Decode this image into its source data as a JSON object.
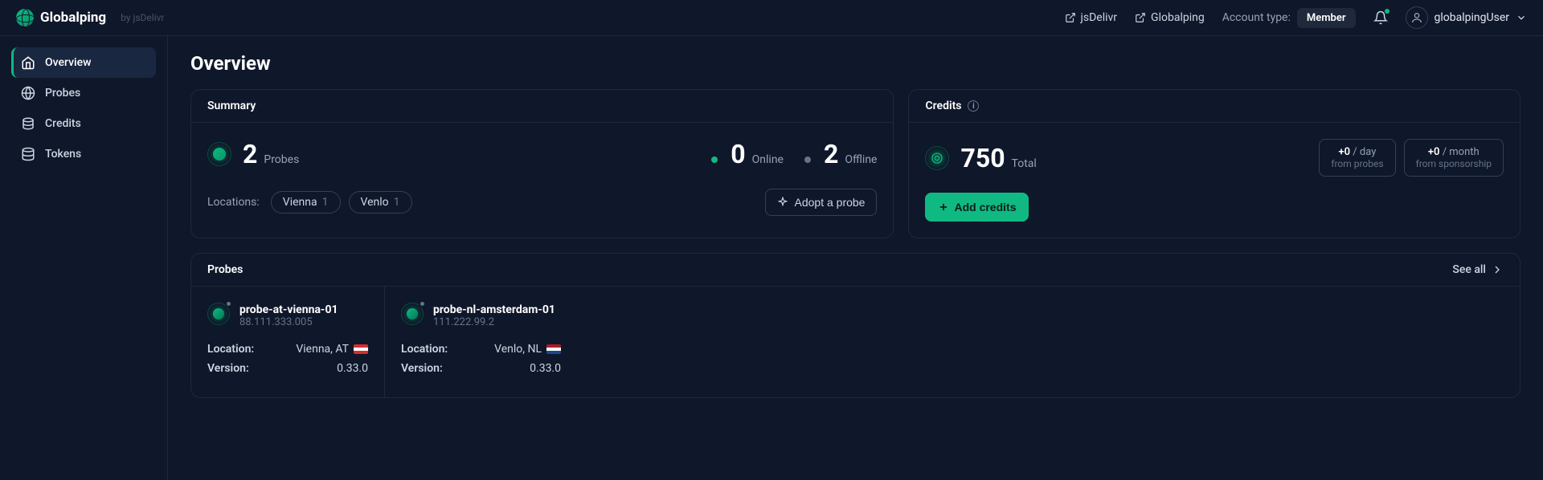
{
  "header": {
    "brand": "Globalping",
    "byline": "by jsDelivr",
    "links": {
      "jsdelivr": "jsDelivr",
      "globalping": "Globalping"
    },
    "account_type_label": "Account type:",
    "account_type_value": "Member",
    "username": "globalpingUser"
  },
  "sidebar": {
    "items": [
      {
        "label": "Overview"
      },
      {
        "label": "Probes"
      },
      {
        "label": "Credits"
      },
      {
        "label": "Tokens"
      }
    ]
  },
  "page": {
    "title": "Overview"
  },
  "summary": {
    "title": "Summary",
    "total_probes": "2",
    "total_probes_label": "Probes",
    "online_count": "0",
    "online_label": "Online",
    "offline_count": "2",
    "offline_label": "Offline",
    "locations_label": "Locations:",
    "locations": [
      {
        "name": "Vienna",
        "count": "1"
      },
      {
        "name": "Venlo",
        "count": "1"
      }
    ],
    "adopt_label": "Adopt a probe"
  },
  "credits": {
    "title": "Credits",
    "total": "750",
    "total_label": "Total",
    "per_day_value": "+0",
    "per_day_unit": "/ day",
    "per_day_sub": "from probes",
    "per_month_value": "+0",
    "per_month_unit": "/ month",
    "per_month_sub": "from sponsorship",
    "add_label": "Add credits"
  },
  "probes": {
    "title": "Probes",
    "see_all": "See all",
    "location_label": "Location:",
    "version_label": "Version:",
    "items": [
      {
        "name": "probe-at-vienna-01",
        "ip": "88.111.333.005",
        "location": "Vienna, AT",
        "flag": "at",
        "version": "0.33.0"
      },
      {
        "name": "probe-nl-amsterdam-01",
        "ip": "111.222.99.2",
        "location": "Venlo, NL",
        "flag": "nl",
        "version": "0.33.0"
      }
    ]
  }
}
